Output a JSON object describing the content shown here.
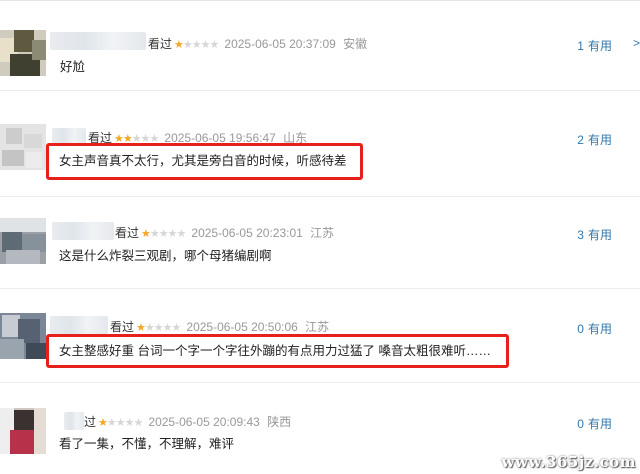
{
  "comments": [
    {
      "rating_label": "看过",
      "stars_on": 1,
      "time": "2025-06-05 20:37:09",
      "location": "安徽",
      "text": "好尬",
      "useful_count": "1",
      "useful_label": "有用",
      "highlighted": false
    },
    {
      "rating_label": "看过",
      "stars_on": 2,
      "time": "2025-06-05 19:56:47",
      "location": "山东",
      "text": "女主声音真不太行，尤其是旁白音的时候，听感待差",
      "useful_count": "2",
      "useful_label": "有用",
      "highlighted": true
    },
    {
      "rating_label": "看过",
      "stars_on": 1,
      "time": "2025-06-05 20:23:01",
      "location": "江苏",
      "text": "这是什么炸裂三观剧，哪个母猪编剧啊",
      "useful_count": "3",
      "useful_label": "有用",
      "highlighted": false
    },
    {
      "rating_label": "看过",
      "stars_on": 1,
      "time": "2025-06-05 20:50:06",
      "location": "江苏",
      "text": "女主整感好重 台词一个字一个字往外蹦的有点用力过猛了 嗓音太粗很难听……",
      "useful_count": "0",
      "useful_label": "有用",
      "highlighted": true
    },
    {
      "rating_label": "过",
      "stars_on": 1,
      "time": "2025-06-05 20:09:43",
      "location": "陕西",
      "text": "看了一集，不懂，不理解，难评",
      "useful_count": "0",
      "useful_label": "有用",
      "highlighted": false
    }
  ],
  "stars_total": 5,
  "edge_arrow": ">",
  "watermark": "www.365jz.com",
  "colors": {
    "star_on": "#f5a623",
    "star_off": "#d6d6d6",
    "useful_link": "#3377aa",
    "highlight_border": "#e8201c"
  }
}
